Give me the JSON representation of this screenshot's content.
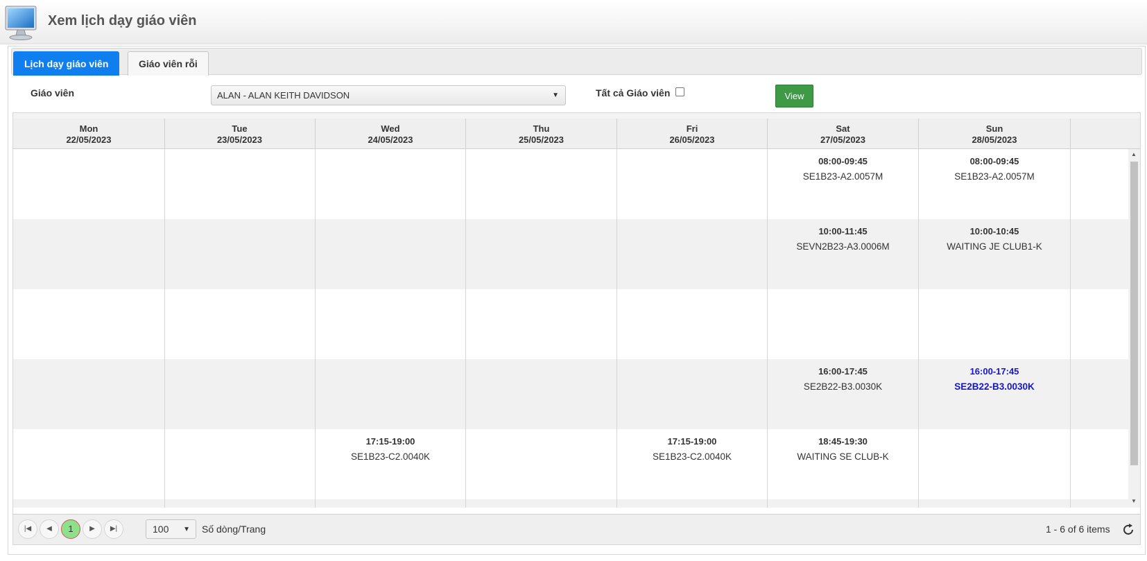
{
  "header": {
    "title": "Xem lịch dạy giáo viên",
    "icon": "monitor-icon"
  },
  "tabs": [
    {
      "label": "Lịch dạy giáo viên",
      "active": true
    },
    {
      "label": "Giáo viên rỗi",
      "active": false
    }
  ],
  "filter": {
    "teacher_label": "Giáo viên",
    "teacher_value": "ALAN - ALAN KEITH DAVIDSON",
    "all_teachers_label": "Tất cả Giáo viên",
    "all_teachers_checked": false,
    "view_button": "View"
  },
  "schedule": {
    "days": [
      {
        "name": "Mon",
        "date": "22/05/2023"
      },
      {
        "name": "Tue",
        "date": "23/05/2023"
      },
      {
        "name": "Wed",
        "date": "24/05/2023"
      },
      {
        "name": "Thu",
        "date": "25/05/2023"
      },
      {
        "name": "Fri",
        "date": "26/05/2023"
      },
      {
        "name": "Sat",
        "date": "27/05/2023"
      },
      {
        "name": "Sun",
        "date": "28/05/2023"
      }
    ],
    "rows": [
      {
        "cells": [
          null,
          null,
          null,
          null,
          null,
          {
            "time": "08:00-09:45",
            "code": "SE1B23-A2.0057M"
          },
          {
            "time": "08:00-09:45",
            "code": "SE1B23-A2.0057M"
          }
        ]
      },
      {
        "cells": [
          null,
          null,
          null,
          null,
          null,
          {
            "time": "10:00-11:45",
            "code": "SEVN2B23-A3.0006M"
          },
          {
            "time": "10:00-10:45",
            "code": "WAITING JE CLUB1-K"
          }
        ]
      },
      {
        "cells": [
          null,
          null,
          null,
          null,
          null,
          null,
          null
        ]
      },
      {
        "cells": [
          null,
          null,
          null,
          null,
          null,
          {
            "time": "16:00-17:45",
            "code": "SE2B22-B3.0030K"
          },
          {
            "time": "16:00-17:45",
            "code": "SE2B22-B3.0030K",
            "highlight": true
          }
        ]
      },
      {
        "cells": [
          null,
          null,
          {
            "time": "17:15-19:00",
            "code": "SE1B23-C2.0040K"
          },
          null,
          {
            "time": "17:15-19:00",
            "code": "SE1B23-C2.0040K"
          },
          {
            "time": "18:45-19:30",
            "code": "WAITING SE CLUB-K"
          },
          null
        ]
      },
      {
        "cells": [
          null,
          null,
          null,
          null,
          null,
          null,
          null
        ]
      }
    ],
    "highlight_color": "#1414d6"
  },
  "pager": {
    "current_page": "1",
    "page_size": "100",
    "page_size_label": "Số dòng/Trang",
    "items_info": "1 - 6 of 6 items"
  },
  "colors": {
    "tab_active": "#0f7ff0",
    "view_button": "#3f9a46",
    "current_page": "#8ee08a"
  }
}
